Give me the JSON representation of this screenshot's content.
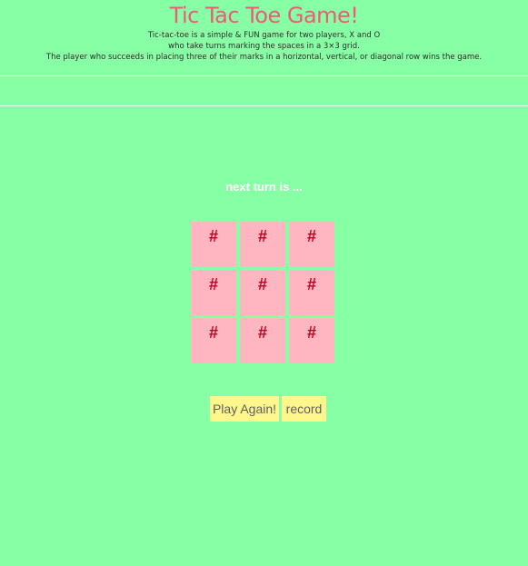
{
  "header": {
    "title": "Tic Tac Toe Game!",
    "desc_line1": "Tic-tac-toe is a simple & FUN game for two players, X and O",
    "desc_line2": "who take turns marking the spaces in a 3×3 grid.",
    "desc_line3": "The player who succeeds in placing three of their marks in a horizontal, vertical, or diagonal row wins the game."
  },
  "status": {
    "turn_text": "next turn is ..."
  },
  "board": {
    "cells": [
      "#",
      "#",
      "#",
      "#",
      "#",
      "#",
      "#",
      "#",
      "#"
    ]
  },
  "buttons": {
    "play_again": "Play Again!",
    "record": "record"
  },
  "colors": {
    "background": "#87ffa5",
    "title": "#ee5b78",
    "cell": "#ffb6c1",
    "cell_text": "#c4001f",
    "button": "#fff68c"
  }
}
